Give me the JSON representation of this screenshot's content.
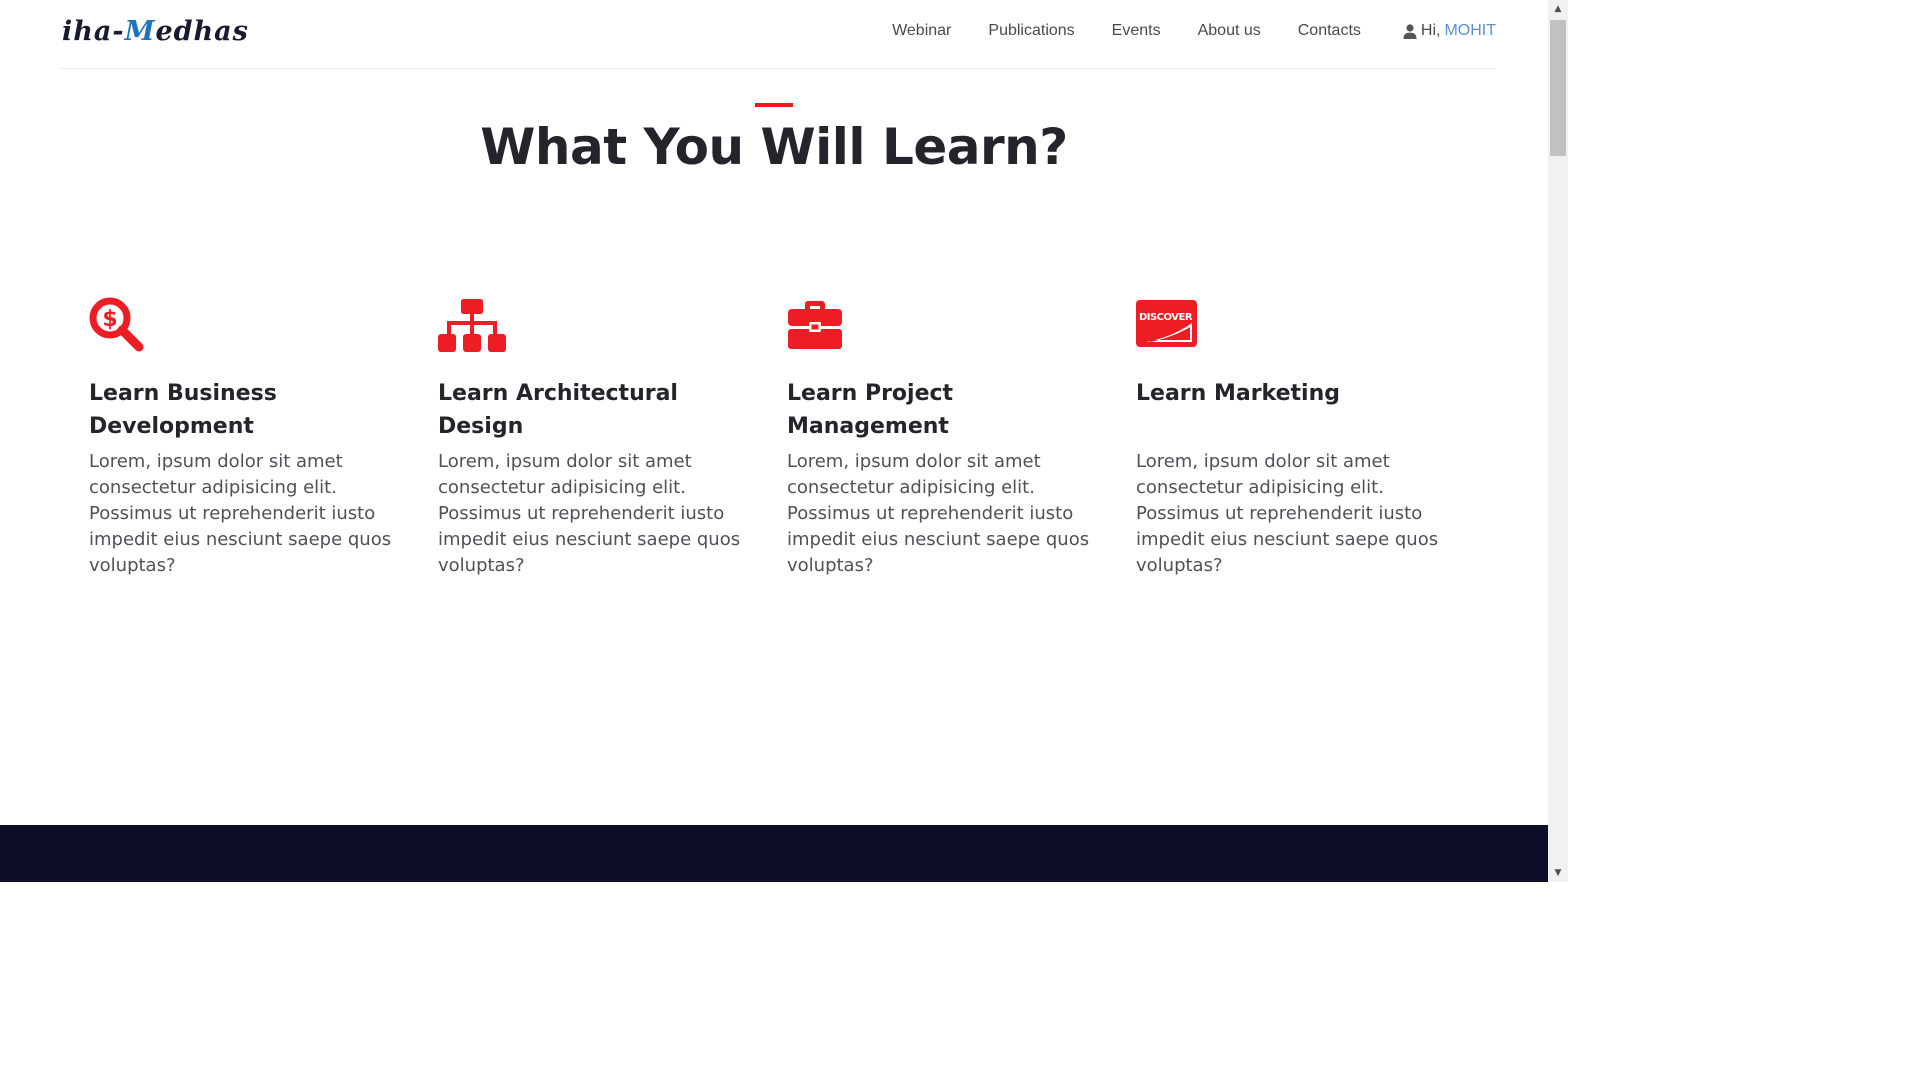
{
  "brand": {
    "part1": "iha-",
    "part2": "M",
    "part3": "edhas"
  },
  "nav": {
    "items": [
      {
        "label": "Webinar"
      },
      {
        "label": "Publications"
      },
      {
        "label": "Events"
      },
      {
        "label": "About us"
      },
      {
        "label": "Contacts"
      }
    ],
    "greeting": "Hi,",
    "user_name": "MOHIT"
  },
  "section": {
    "title": "What You Will Learn?",
    "features": [
      {
        "icon": "dollar-search-icon",
        "title": "Learn Business Development",
        "text": "Lorem, ipsum dolor sit amet consectetur adipisicing elit. Possimus ut reprehenderit iusto impedit eius nesciunt saepe quos voluptas?"
      },
      {
        "icon": "sitemap-icon",
        "title": "Learn Architectural Design",
        "text": "Lorem, ipsum dolor sit amet consectetur adipisicing elit. Possimus ut reprehenderit iusto impedit eius nesciunt saepe quos voluptas?"
      },
      {
        "icon": "toolbox-icon",
        "title": "Learn Project Management",
        "text": "Lorem, ipsum dolor sit amet consectetur adipisicing elit. Possimus ut reprehenderit iusto impedit eius nesciunt saepe quos voluptas?"
      },
      {
        "icon": "discover-card-icon",
        "title": "Learn Marketing",
        "text": "Lorem, ipsum dolor sit amet consectetur adipisicing elit. Possimus ut reprehenderit iusto impedit eius nesciunt saepe quos voluptas?"
      }
    ],
    "discover_label": "DISCOVER"
  },
  "colors": {
    "accent": "#e8191f",
    "icon_red": "#ee1c25",
    "user_link": "#5b8fd6",
    "footer": "#0c0e27"
  }
}
